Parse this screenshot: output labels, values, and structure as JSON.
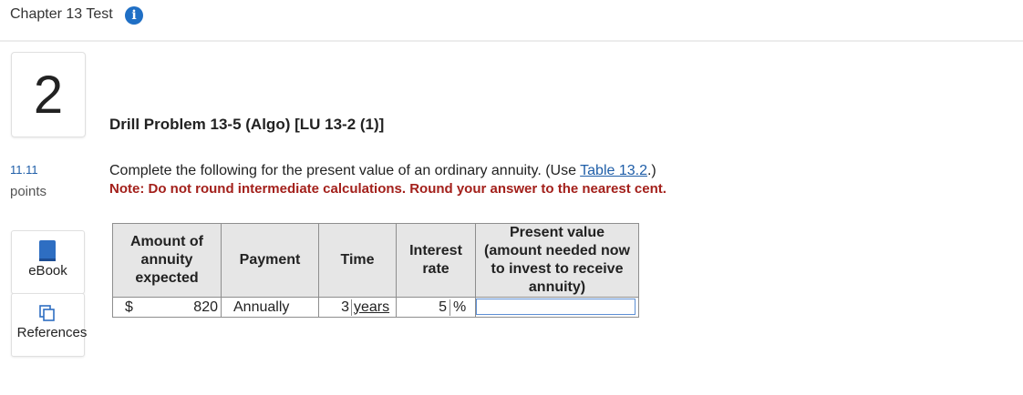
{
  "header": {
    "title": "Chapter 13 Test",
    "info_icon": "info-icon"
  },
  "question": {
    "number": "2",
    "points_value": "11.11",
    "points_label": "points"
  },
  "tools": {
    "ebook_label": "eBook",
    "references_label": "References"
  },
  "problem": {
    "title": "Drill Problem 13-5 (Algo) [LU 13-2 (1)]",
    "instruction_pre": "Complete the following for the present value of an ordinary annuity. (Use ",
    "instruction_link": "Table 13.2",
    "instruction_post": ".)",
    "note": "Note: Do not round intermediate calculations. Round your answer to the nearest cent."
  },
  "table": {
    "headers": [
      "Amount of annuity expected",
      "Payment",
      "Time",
      "Interest rate",
      "Present value (amount needed now to invest to receive annuity)"
    ],
    "row": {
      "currency": "$",
      "amount": "820",
      "payment": "Annually",
      "time_value": "3",
      "time_unit": "years",
      "rate_value": "5",
      "rate_unit": "%",
      "present_value": ""
    }
  }
}
